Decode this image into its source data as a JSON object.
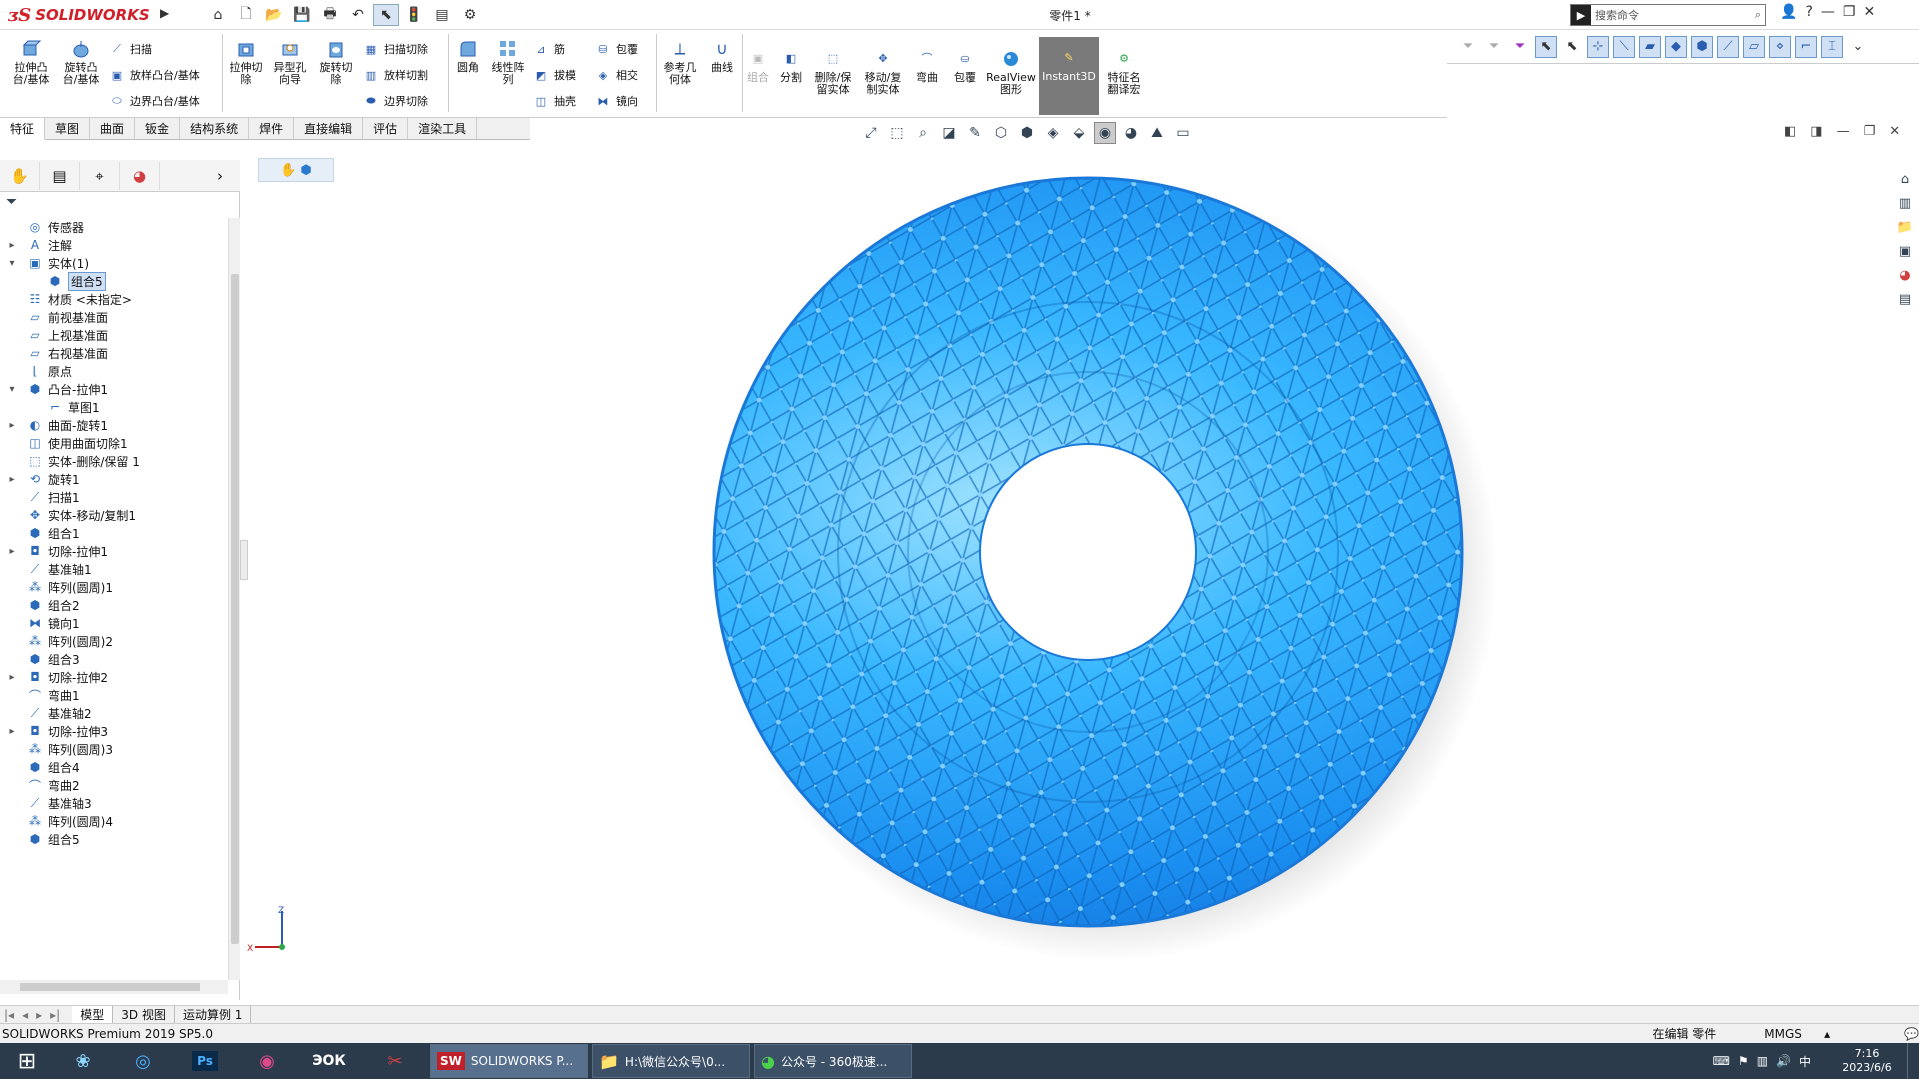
{
  "app": {
    "logo_text": "SOLIDWORKS",
    "document_title": "零件1 *",
    "search_placeholder": "搜索命令"
  },
  "ribbon": {
    "extrude_boss": "拉伸凸\n台/基体",
    "revolve_boss": "旋转凸\n台/基体",
    "sweep": "扫描",
    "loft_boss": "放样凸台/基体",
    "boundary_boss": "边界凸台/基体",
    "extrude_cut": "拉伸切\n除",
    "hole_wizard": "异型孔\n向导",
    "revolve_cut": "旋转切\n除",
    "sweep_cut": "扫描切除",
    "loft_cut": "放样切割",
    "boundary_cut": "边界切除",
    "fillet": "圆角",
    "linear_pattern": "线性阵\n列",
    "rib": "筋",
    "draft": "拔模",
    "shell": "抽壳",
    "wrap": "包覆",
    "intersect": "相交",
    "mirror": "镜向",
    "ref_geometry": "参考几\n何体",
    "curves": "曲线",
    "combine": "组合",
    "split": "分割",
    "delete_keep_body": "删除/保\n留实体",
    "move_copy_body": "移动/复\n制实体",
    "flex": "弯曲",
    "wrap2": "包覆",
    "realview": "RealView\n图形",
    "instant3d": "Instant3D",
    "feature_translate": "特征名\n翻译宏"
  },
  "tabs": [
    "特征",
    "草图",
    "曲面",
    "钣金",
    "结构系统",
    "焊件",
    "直接编辑",
    "评估",
    "渲染工具"
  ],
  "tree": [
    {
      "label": "传感器",
      "icon": "sensor-icon",
      "expand": "",
      "indent": 0
    },
    {
      "label": "注解",
      "icon": "annotation-icon",
      "expand": "▸",
      "indent": 0
    },
    {
      "label": "实体(1)",
      "icon": "solid-bodies-icon",
      "expand": "▾",
      "indent": 0
    },
    {
      "label": "组合5",
      "icon": "body-icon",
      "expand": "",
      "indent": 1,
      "selected": true
    },
    {
      "label": "材质 <未指定>",
      "icon": "material-icon",
      "expand": "",
      "indent": 0
    },
    {
      "label": "前视基准面",
      "icon": "plane-icon",
      "expand": "",
      "indent": 0
    },
    {
      "label": "上视基准面",
      "icon": "plane-icon",
      "expand": "",
      "indent": 0
    },
    {
      "label": "右视基准面",
      "icon": "plane-icon",
      "expand": "",
      "indent": 0
    },
    {
      "label": "原点",
      "icon": "origin-icon",
      "expand": "",
      "indent": 0
    },
    {
      "label": "凸台-拉伸1",
      "icon": "extrude-icon",
      "expand": "▾",
      "indent": 0
    },
    {
      "label": "草图1",
      "icon": "sketch-icon",
      "expand": "",
      "indent": 1
    },
    {
      "label": "曲面-旋转1",
      "icon": "surface-revolve-icon",
      "expand": "▸",
      "indent": 0
    },
    {
      "label": "使用曲面切除1",
      "icon": "surface-cut-icon",
      "expand": "",
      "indent": 0
    },
    {
      "label": "实体-删除/保留 1",
      "icon": "delete-body-icon",
      "expand": "",
      "indent": 0
    },
    {
      "label": "旋转1",
      "icon": "revolve-icon",
      "expand": "▸",
      "indent": 0
    },
    {
      "label": "扫描1",
      "icon": "sweep-icon",
      "expand": "",
      "indent": 0
    },
    {
      "label": "实体-移动/复制1",
      "icon": "move-body-icon",
      "expand": "",
      "indent": 0
    },
    {
      "label": "组合1",
      "icon": "combine-icon",
      "expand": "",
      "indent": 0
    },
    {
      "label": "切除-拉伸1",
      "icon": "cut-extrude-icon",
      "expand": "▸",
      "indent": 0
    },
    {
      "label": "基准轴1",
      "icon": "axis-icon",
      "expand": "",
      "indent": 0
    },
    {
      "label": "阵列(圆周)1",
      "icon": "circular-pattern-icon",
      "expand": "",
      "indent": 0
    },
    {
      "label": "组合2",
      "icon": "combine-icon",
      "expand": "",
      "indent": 0
    },
    {
      "label": "镜向1",
      "icon": "mirror-icon",
      "expand": "",
      "indent": 0
    },
    {
      "label": "阵列(圆周)2",
      "icon": "circular-pattern-icon",
      "expand": "",
      "indent": 0
    },
    {
      "label": "组合3",
      "icon": "combine-icon",
      "expand": "",
      "indent": 0
    },
    {
      "label": "切除-拉伸2",
      "icon": "cut-extrude-icon",
      "expand": "▸",
      "indent": 0
    },
    {
      "label": "弯曲1",
      "icon": "flex-icon",
      "expand": "",
      "indent": 0
    },
    {
      "label": "基准轴2",
      "icon": "axis-icon",
      "expand": "",
      "indent": 0
    },
    {
      "label": "切除-拉伸3",
      "icon": "cut-extrude-icon",
      "expand": "▸",
      "indent": 0
    },
    {
      "label": "阵列(圆周)3",
      "icon": "circular-pattern-icon",
      "expand": "",
      "indent": 0
    },
    {
      "label": "组合4",
      "icon": "combine-icon",
      "expand": "",
      "indent": 0
    },
    {
      "label": "弯曲2",
      "icon": "flex-icon",
      "expand": "",
      "indent": 0
    },
    {
      "label": "基准轴3",
      "icon": "axis-icon",
      "expand": "",
      "indent": 0
    },
    {
      "label": "阵列(圆周)4",
      "icon": "circular-pattern-icon",
      "expand": "",
      "indent": 0
    },
    {
      "label": "组合5",
      "icon": "combine-icon",
      "expand": "",
      "indent": 0
    }
  ],
  "bottom_tabs": [
    "模型",
    "3D 视图",
    "运动算例 1"
  ],
  "status": {
    "product": "SOLIDWORKS Premium 2019 SP5.0",
    "mode": "在编辑 零件",
    "units": "MMGS"
  },
  "triad": {
    "y_label": "Z",
    "x_label": "X"
  },
  "taskbar": {
    "tasks": [
      {
        "label": "SOLIDWORKS P...",
        "icon": "solidworks-icon",
        "active": true
      },
      {
        "label": "H:\\微信公众号\\0...",
        "icon": "folder-icon",
        "active": false
      },
      {
        "label": "公众号 - 360极速...",
        "icon": "browser-icon",
        "active": false
      }
    ],
    "time": "7:16",
    "date": "2023/6/6"
  },
  "colors": {
    "model_blue": "#1e9fff",
    "logo_red": "#d0202a",
    "taskbar": "#2b3b4c"
  }
}
